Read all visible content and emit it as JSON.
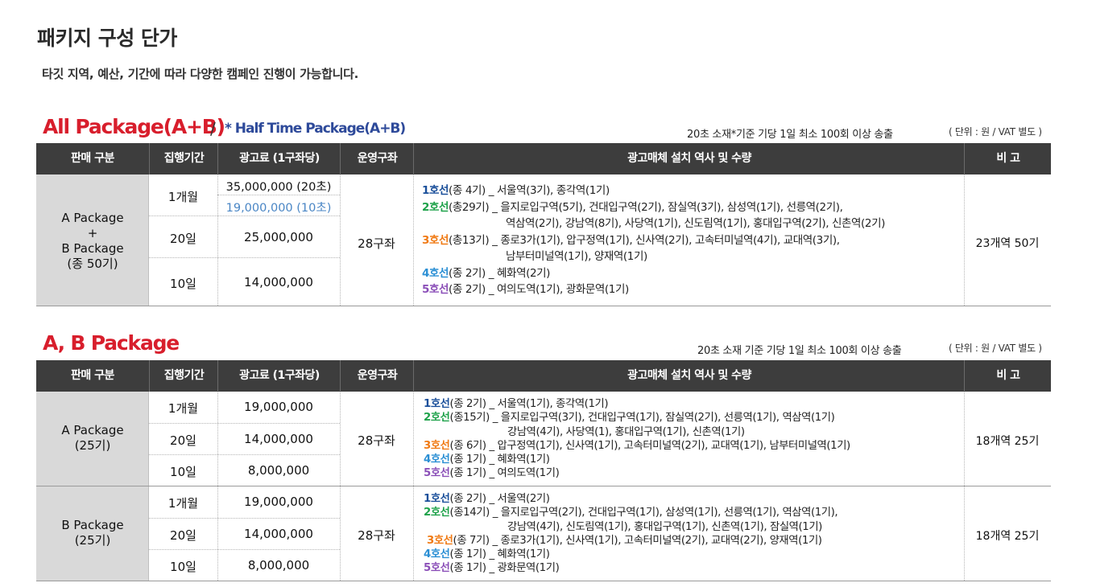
{
  "page": {
    "title": "패키지 구성 단가",
    "subtitle": "타깃 지역, 예산, 기간에 따라 다양한 캠페인 진행이 가능합니다."
  },
  "headers": [
    "판매 구분",
    "집행기간",
    "광고료 (1구좌당)",
    "운영구좌",
    "광고매체 설치 역사 및 수량",
    "비 고"
  ],
  "section1": {
    "title": "All Package(A+B)",
    "slash": "/",
    "half_title": "* Half Time Package(A+B)",
    "note": "20초 소재*기준  기당 1일 최소 100회 이상 송출",
    "unit": "( 단위 : 원  /  VAT 별도 )",
    "row": {
      "package_line1": "A Package",
      "package_line2": "+",
      "package_line3": "B Package",
      "package_line4": "(종 50기)",
      "periods": [
        "1개월",
        "20일",
        "10일"
      ],
      "price_1m_a": "35,000,000 (20초)",
      "price_1m_b": "19,000,000 (10초)",
      "price_20": "25,000,000",
      "price_10": "14,000,000",
      "slots": "28구좌",
      "remark": "23개역 50기",
      "stations": [
        {
          "line": "1호선",
          "text": "(종 4기) _ 서울역(3기),  종각역(1기)"
        },
        {
          "line": "2호선",
          "text": "(총29기) _ 을지로입구역(5기),  건대입구역(2기),  잠실역(3기),  삼성역(1기),  선릉역(2기),"
        },
        {
          "cont": "역삼역(2기),  강남역(8기),  사당역(1기),  신도림역(1기),  홍대입구역(2기),  신촌역(2기)"
        },
        {
          "line": "3호선",
          "text": "(총13기) _ 종로3가(1기),  압구정역(1기),  신사역(2기),  고속터미널역(4기),  교대역(3기),"
        },
        {
          "cont": "남부터미널역(1기),  양재역(1기)"
        },
        {
          "line": "4호선",
          "text": "(종 2기) _ 혜화역(2기)"
        },
        {
          "line": "5호선",
          "text": "(종 2기) _ 여의도역(1기),  광화문역(1기)"
        }
      ]
    }
  },
  "section2": {
    "title": "A, B Package",
    "note": "20초 소재 기준  기당 1일 최소 100회 이상 송출",
    "unit": "( 단위 : 원  /  VAT 별도 )",
    "rows": [
      {
        "package_line1": "A Package",
        "package_line2": "(25기)",
        "periods": [
          "1개월",
          "20일",
          "10일"
        ],
        "prices": [
          "19,000,000",
          "14,000,000",
          "8,000,000"
        ],
        "slots": "28구좌",
        "remark": "18개역 25기",
        "stations": [
          {
            "line": "1호선",
            "text": "(종 2기) _ 서울역(1기),  종각역(1기)"
          },
          {
            "line": "2호선",
            "text": "(종15기) _ 을지로입구역(3기),  건대입구역(1기),  잠실역(2기),  선릉역(1기),  역삼역(1기)"
          },
          {
            "cont": "강남역(4기),  사당역(1),  홍대입구역(1기),  신촌역(1기)"
          },
          {
            "line": "3호선",
            "text": "(종 6기) _ 압구정역(1기),  신사역(1기),  고속터미널역(2기),  교대역(1기),  남부터미널역(1기)"
          },
          {
            "line": "4호선",
            "text": "(종 1기) _ 혜화역(1기)"
          },
          {
            "line": "5호선",
            "text": "(종 1기) _ 여의도역(1기)"
          }
        ]
      },
      {
        "package_line1": "B Package",
        "package_line2": "(25기)",
        "periods": [
          "1개월",
          "20일",
          "10일"
        ],
        "prices": [
          "19,000,000",
          "14,000,000",
          "8,000,000"
        ],
        "slots": "28구좌",
        "remark": "18개역 25기",
        "stations": [
          {
            "line": "1호선",
            "text": "(종 2기) _ 서울역(2기)"
          },
          {
            "line": "2호선",
            "text": "(종14기) _ 을지로입구역(2기),  건대입구역(1기),  삼성역(1기),  선릉역(1기),  역삼역(1기),"
          },
          {
            "cont": "강남역(4기),  신도림역(1기),  홍대입구역(1기),  신촌역(1기),  잠실역(1기)"
          },
          {
            "line": "3호선",
            "text": "(종 7기) _ 종로3가(1기),  신사역(1기),  고속터미널역(2기),  교대역(2기),  양재역(1기)"
          },
          {
            "line": "4호선",
            "text": "(종 1기) _ 혜화역(1기)"
          },
          {
            "line": "5호선",
            "text": "(종 1기) _ 광화문역(1기)"
          }
        ]
      }
    ]
  },
  "colors": {
    "accent_red": "#d81e2c",
    "half_blue": "#2e4a9a",
    "header_bg": "#3d3d3d",
    "line1": "#1a4f9a",
    "line2": "#1ea24a",
    "line3": "#f07a14",
    "line4": "#2b8fd4",
    "line5": "#8b4fb8"
  }
}
